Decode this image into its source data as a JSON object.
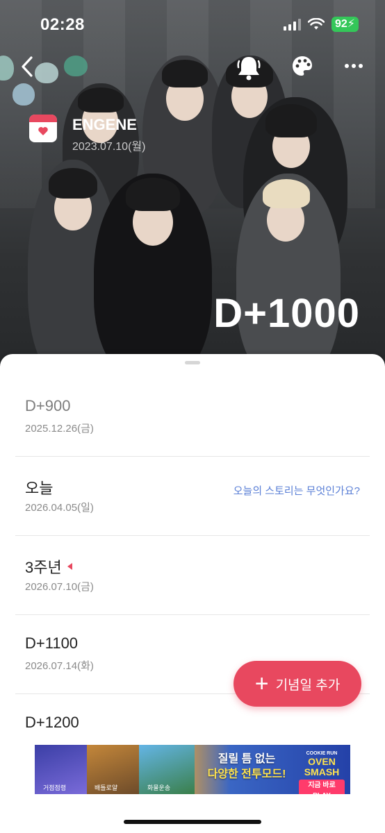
{
  "status_bar": {
    "time": "02:28",
    "battery": "92"
  },
  "header": {
    "name": "ENGENE",
    "start_date": "2023.07.10(월)",
    "dday": "D+1000"
  },
  "list": [
    {
      "title": "D+900",
      "date": "2025.12.26(금)",
      "state": "past"
    },
    {
      "title": "오늘",
      "date": "2026.04.05(일)",
      "prompt": "오늘의 스토리는 무엇인가요?"
    },
    {
      "title": "3주년",
      "date": "2026.07.10(금)",
      "marker": "red-triangle"
    },
    {
      "title": "D+1100",
      "date": "2026.07.14(화)"
    },
    {
      "title": "D+1200",
      "date": ""
    }
  ],
  "fab": {
    "label": "기념일 추가",
    "icon": "plus-icon"
  },
  "ad": {
    "line1": "질릴 틈 없는",
    "line2": "다양한 전투모드!",
    "brand": "OVEN SMASH",
    "brand_top": "COOKIE RUN",
    "play_label": "지금 바로 PLAY",
    "captions": [
      "거점점령",
      "배틀로얄",
      "화물운송"
    ]
  },
  "colors": {
    "accent": "#e8485f",
    "link": "#5a7fd6",
    "battery": "#34c759"
  }
}
